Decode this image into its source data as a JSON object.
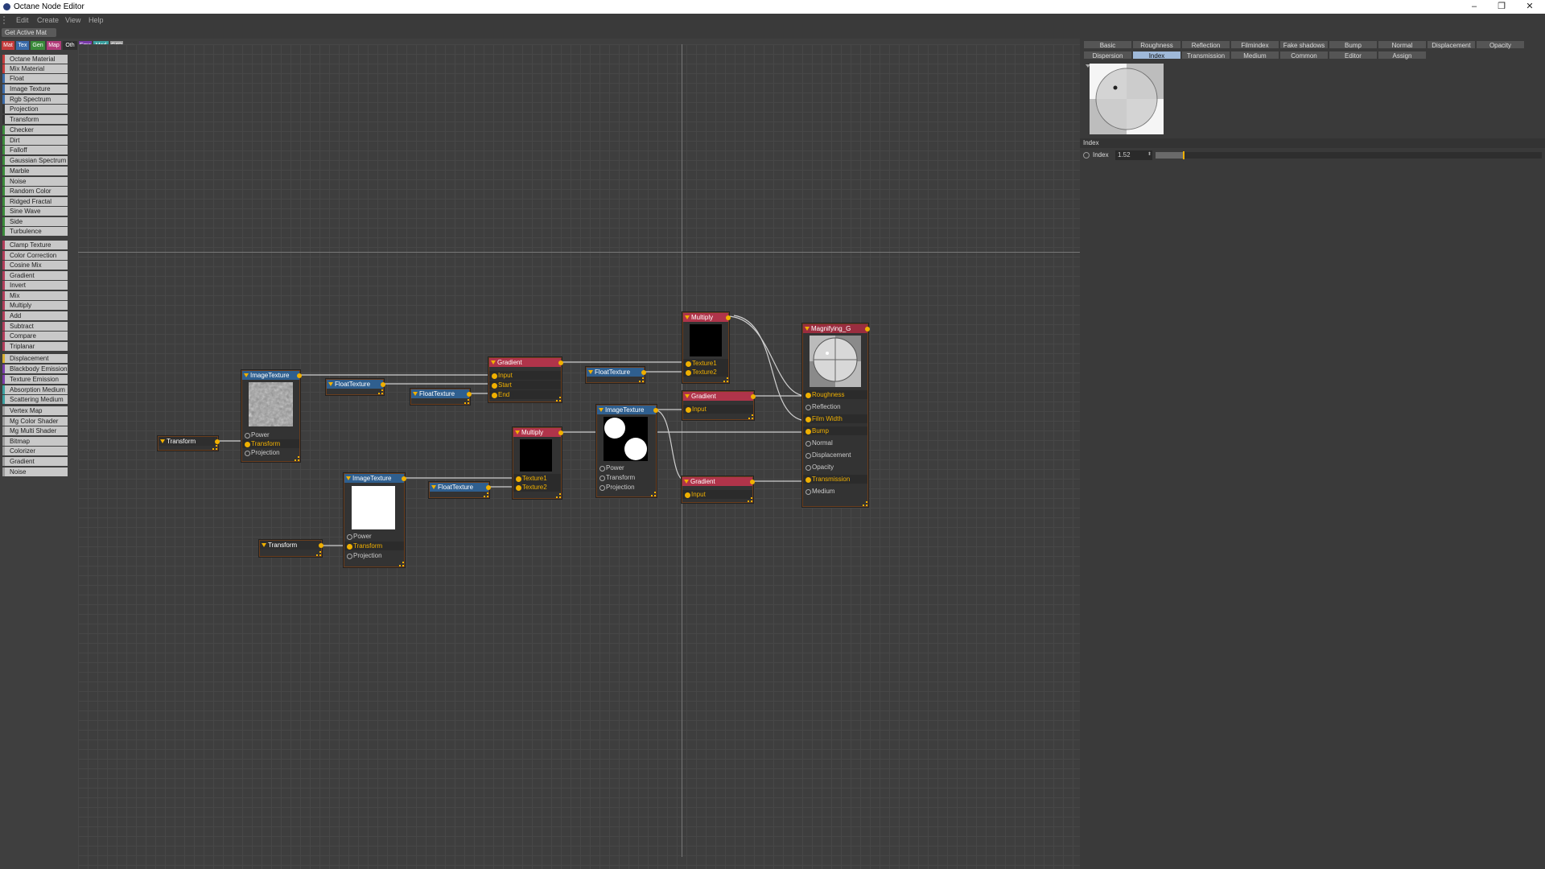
{
  "window": {
    "title": "Octane Node Editor",
    "min": "–",
    "max": "❐",
    "close": "✕"
  },
  "menu": [
    "Edit",
    "Create",
    "View",
    "Help"
  ],
  "toolbar": {
    "get_active_mat": "Get Active Mat"
  },
  "category_tabs": [
    {
      "label": "Mat",
      "color": "#c43a3a"
    },
    {
      "label": "Tex",
      "color": "#3a6aa8"
    },
    {
      "label": "Gen",
      "color": "#3a8a3a"
    },
    {
      "label": "Map",
      "color": "#b23c7a"
    },
    {
      "label": "Oth",
      "color": "#2f2f2f"
    },
    {
      "label": "Ems",
      "color": "#7a3aaa"
    },
    {
      "label": "Med",
      "color": "#3aa0a0"
    },
    {
      "label": "C4D",
      "color": "#9a9a9a"
    }
  ],
  "node_list": [
    {
      "label": "Octane Material",
      "color": "#c43a3a"
    },
    {
      "label": "Mix Material",
      "color": "#c43a3a"
    },
    {
      "label": "Float",
      "color": "#3a6aa8"
    },
    {
      "label": "Image Texture",
      "color": "#3a6aa8"
    },
    {
      "label": "Rgb Spectrum",
      "color": "#3a6aa8"
    },
    {
      "label": "Projection",
      "color": "#333333"
    },
    {
      "label": "Transform",
      "color": "#333333"
    },
    {
      "label": "Checker",
      "color": "#3a8a3a"
    },
    {
      "label": "Dirt",
      "color": "#3a8a3a"
    },
    {
      "label": "Falloff",
      "color": "#3a8a3a"
    },
    {
      "label": "Gaussian Spectrum",
      "color": "#3a8a3a"
    },
    {
      "label": "Marble",
      "color": "#3a8a3a"
    },
    {
      "label": "Noise",
      "color": "#3a8a3a"
    },
    {
      "label": "Random Color",
      "color": "#3a8a3a"
    },
    {
      "label": "Ridged Fractal",
      "color": "#3a8a3a"
    },
    {
      "label": "Sine Wave",
      "color": "#3a8a3a"
    },
    {
      "label": "Side",
      "color": "#3a8a3a"
    },
    {
      "label": "Turbulence",
      "color": "#3a8a3a"
    },
    {
      "label": "Clamp Texture",
      "color": "#b23c5a"
    },
    {
      "label": "Color Correction",
      "color": "#b23c5a"
    },
    {
      "label": "Cosine Mix",
      "color": "#b23c5a"
    },
    {
      "label": "Gradient",
      "color": "#b23c5a"
    },
    {
      "label": "Invert",
      "color": "#b23c5a"
    },
    {
      "label": "Mix",
      "color": "#b23c5a"
    },
    {
      "label": "Multiply",
      "color": "#b23c5a"
    },
    {
      "label": "Add",
      "color": "#b23c5a"
    },
    {
      "label": "Subtract",
      "color": "#b23c5a"
    },
    {
      "label": "Compare",
      "color": "#b23c5a"
    },
    {
      "label": "Triplanar",
      "color": "#b23c5a"
    },
    {
      "label": "Displacement",
      "color": "#d9b030"
    },
    {
      "label": "Blackbody Emission",
      "color": "#7a3aaa"
    },
    {
      "label": "Texture Emission",
      "color": "#7a3aaa"
    },
    {
      "label": "Absorption Medium",
      "color": "#3aa0a0"
    },
    {
      "label": "Scattering Medium",
      "color": "#3aa0a0"
    },
    {
      "label": "Vertex Map",
      "color": "#9a9a9a"
    },
    {
      "label": "Mg Color Shader",
      "color": "#9a9a9a"
    },
    {
      "label": "Mg Multi Shader",
      "color": "#9a9a9a"
    },
    {
      "label": "Bitmap",
      "color": "#9a9a9a"
    },
    {
      "label": "Colorizer",
      "color": "#9a9a9a"
    },
    {
      "label": "Gradient",
      "color": "#9a9a9a"
    },
    {
      "label": "Noise",
      "color": "#9a9a9a"
    }
  ],
  "nodes": {
    "transform1": {
      "title": "Transform"
    },
    "imagetex1": {
      "title": "ImageTexture",
      "ports": [
        "Power",
        "Transform",
        "Projection"
      ]
    },
    "floattex1": {
      "title": "FloatTexture"
    },
    "floattex2": {
      "title": "FloatTexture"
    },
    "gradient1": {
      "title": "Gradient",
      "ports": [
        "Input",
        "Start",
        "End"
      ]
    },
    "floattex3": {
      "title": "FloatTexture"
    },
    "multiply1": {
      "title": "Multiply",
      "ports": [
        "Texture1",
        "Texture2"
      ]
    },
    "gradient2": {
      "title": "Gradient",
      "ports": [
        "Input"
      ]
    },
    "imagetex2": {
      "title": "ImageTexture",
      "ports": [
        "Power",
        "Transform",
        "Projection"
      ]
    },
    "multiply2": {
      "title": "Multiply",
      "ports": [
        "Texture1",
        "Texture2"
      ]
    },
    "floattex4": {
      "title": "FloatTexture"
    },
    "imagetex3": {
      "title": "ImageTexture",
      "ports": [
        "Power",
        "Transform",
        "Projection"
      ]
    },
    "transform2": {
      "title": "Transform"
    },
    "gradient3": {
      "title": "Gradient",
      "ports": [
        "Input"
      ]
    },
    "material": {
      "title": "Magnifying_G",
      "ports": [
        "Roughness",
        "Reflection",
        "Film Width",
        "Bump",
        "Normal",
        "Displacement",
        "Opacity",
        "Transmission",
        "Medium"
      ]
    }
  },
  "right_tabs_row1": [
    "Basic",
    "Roughness",
    "Reflection",
    "Filmindex",
    "Fake shadows",
    "Bump",
    "Normal",
    "Displacement",
    "Opacity"
  ],
  "right_tabs_row2": [
    "Dispersion",
    "Index",
    "Transmission",
    "Medium",
    "Common",
    "Editor",
    "Assign"
  ],
  "selected_tab": "Index",
  "index_section": {
    "header": "Index",
    "label": "Index",
    "value": "1.52",
    "slider_fraction": 0.07
  }
}
